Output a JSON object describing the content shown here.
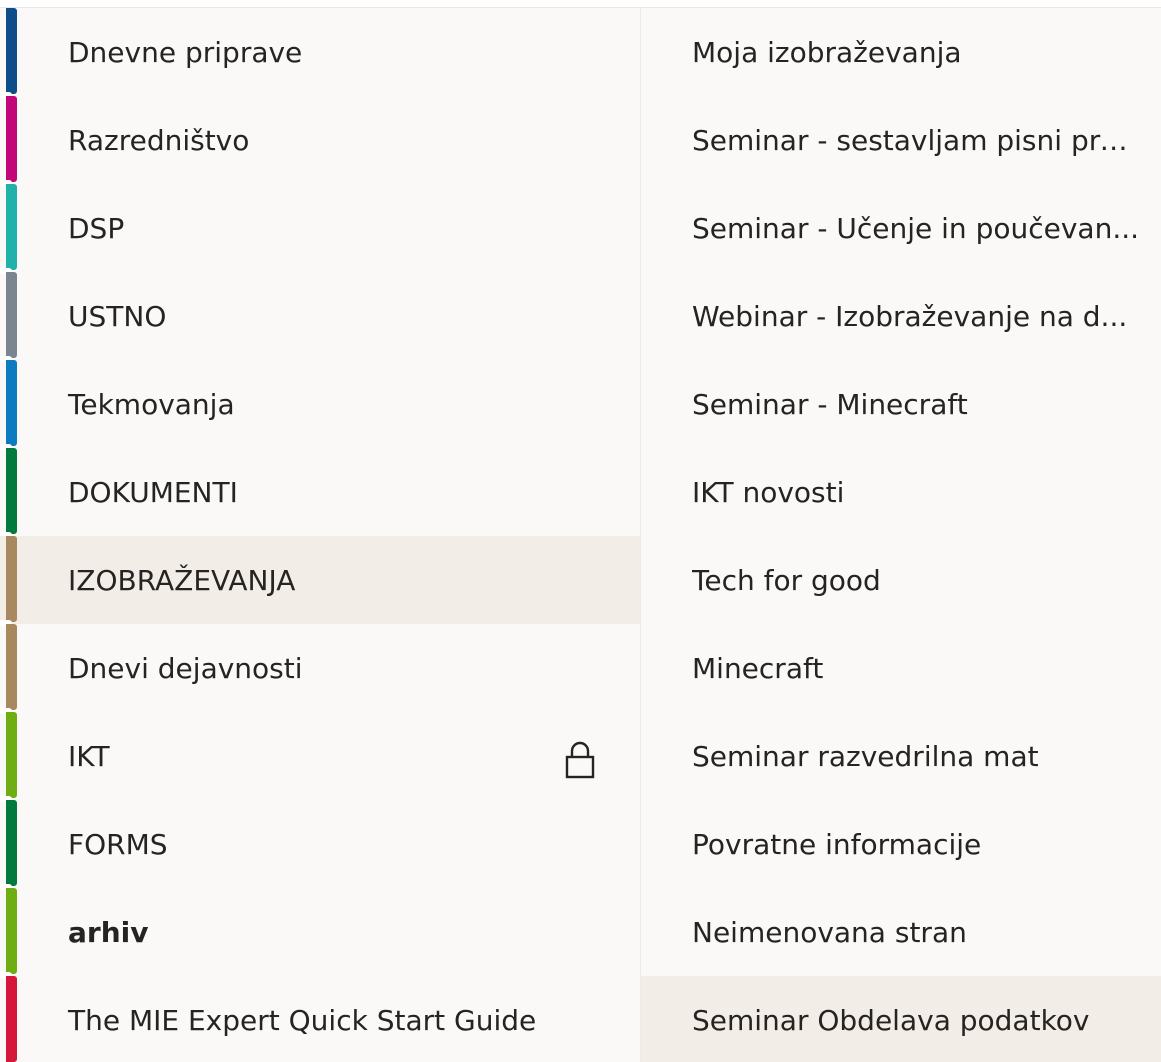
{
  "sections": {
    "items": [
      {
        "label": "Dnevne priprave",
        "color": "#0f4c8a"
      },
      {
        "label": "Razredništvo",
        "color": "#c3057a"
      },
      {
        "label": "DSP",
        "color": "#20b2aa"
      },
      {
        "label": "USTNO",
        "color": "#7a8590"
      },
      {
        "label": "Tekmovanja",
        "color": "#0c7cc1"
      },
      {
        "label": "DOKUMENTI",
        "color": "#037a3d"
      },
      {
        "label": "IZOBRAŽEVANJA",
        "color": "#a8895f",
        "selected": true
      },
      {
        "label": "Dnevi dejavnosti",
        "color": "#a8895f"
      },
      {
        "label": "IKT",
        "color": "#6fae12",
        "locked": true
      },
      {
        "label": "FORMS",
        "color": "#037a3d"
      },
      {
        "label": "arhiv",
        "color": "#6fae12",
        "bold": true
      },
      {
        "label": "The MIE Expert Quick Start Guide",
        "color": "#d4173a"
      }
    ]
  },
  "pages": {
    "items": [
      {
        "label": "Moja izobraževanja"
      },
      {
        "label": "Seminar - sestavljam pisni pre..."
      },
      {
        "label": "Seminar - Učenje in poučevan..."
      },
      {
        "label": "Webinar - Izobraževanje na d..."
      },
      {
        "label": "Seminar - Minecraft"
      },
      {
        "label": "IKT novosti"
      },
      {
        "label": "Tech for good"
      },
      {
        "label": "Minecraft"
      },
      {
        "label": "Seminar razvedrilna mat"
      },
      {
        "label": "Povratne informacije"
      },
      {
        "label": "Neimenovana stran"
      },
      {
        "label": "Seminar Obdelava podatkov",
        "selected": true
      }
    ]
  },
  "colors": {
    "pane_bg": "#faf9f8",
    "selected_bg": "#f3ede7",
    "text": "#252423"
  },
  "icons": {
    "lock": "lock-icon"
  }
}
